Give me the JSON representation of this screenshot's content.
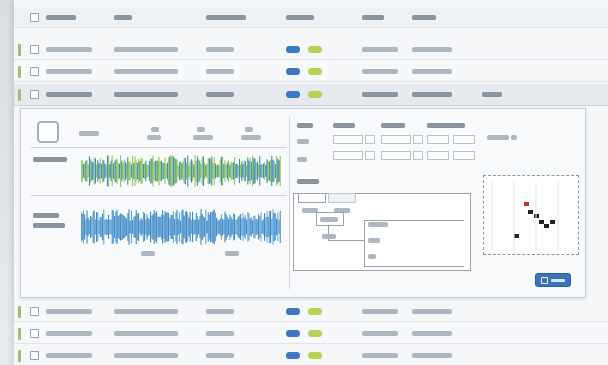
{
  "table": {
    "columns": [
      "",
      "",
      "",
      "",
      "",
      ""
    ],
    "rows": [
      {
        "cells": [
          "",
          "",
          "",
          "",
          ""
        ],
        "expanded": false
      },
      {
        "cells": [
          "",
          "",
          "",
          "",
          ""
        ],
        "expanded": false
      },
      {
        "cells": [
          "",
          "",
          "",
          "",
          "",
          ""
        ],
        "expanded": true
      },
      {
        "cells": [
          "",
          "",
          "",
          "",
          ""
        ],
        "expanded": false
      },
      {
        "cells": [
          "",
          "",
          "",
          "",
          ""
        ],
        "expanded": false
      },
      {
        "cells": [
          "",
          "",
          "",
          "",
          ""
        ],
        "expanded": false
      }
    ]
  },
  "detail": {
    "track_labels": [
      "",
      ""
    ],
    "scale_labels": [
      "",
      "",
      "",
      ""
    ],
    "form": {
      "row_labels": [
        "",
        "",
        ""
      ],
      "col_labels": [
        "",
        "",
        ""
      ],
      "section_label": "",
      "tabs": [
        "",
        ""
      ],
      "right_label": ""
    },
    "save_label": ""
  },
  "colors": {
    "status_blue": "#3f78c2",
    "status_green": "#b7d257",
    "wave_green": "#8cc63f",
    "wave_blue": "#2f7fc1",
    "marker": "#9fbe6e",
    "accent": "#3d72b8"
  },
  "icons": [
    "checkbox-icon",
    "status-chip-icon",
    "thumbnail-icon",
    "save-icon"
  ]
}
